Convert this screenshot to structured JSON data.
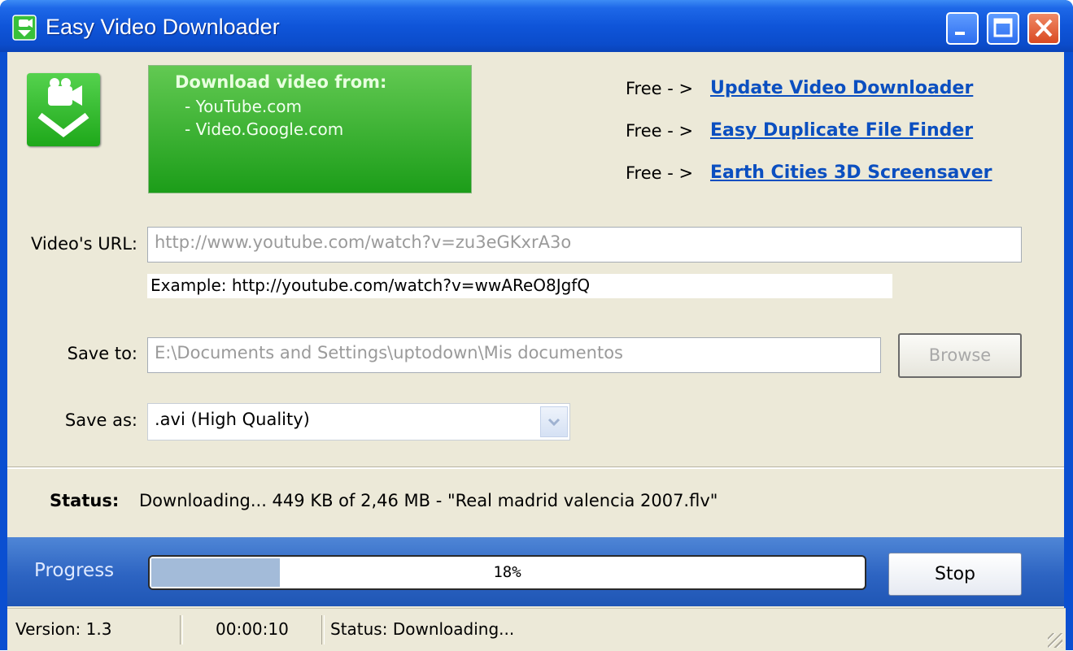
{
  "window": {
    "title": "Easy Video Downloader"
  },
  "banner": {
    "title": "Download video from:",
    "sources": [
      "- YouTube.com",
      "- Video.Google.com"
    ]
  },
  "promos": [
    {
      "prefix": "Free - >",
      "link": "Update Video Downloader"
    },
    {
      "prefix": "Free - >",
      "link": "Easy Duplicate File Finder"
    },
    {
      "prefix": "Free - >",
      "link": "Earth Cities 3D Screensaver"
    }
  ],
  "url_field": {
    "label": "Video's URL:",
    "placeholder": "http://www.youtube.com/watch?v=zu3eGKxrA3o",
    "example": "Example: http://youtube.com/watch?v=wwAReO8JgfQ"
  },
  "save_to": {
    "label": "Save to:",
    "value": "E:\\Documents and Settings\\uptodown\\Mis documentos",
    "browse_label": "Browse"
  },
  "save_as": {
    "label": "Save as:",
    "selected": ".avi (High Quality)"
  },
  "status": {
    "label": "Status:",
    "text": "Downloading... 449 KB of 2,46 MB - \"Real madrid valencia 2007.flv\""
  },
  "progress": {
    "label": "Progress",
    "percent": 18,
    "percent_text": "18%",
    "stop_label": "Stop"
  },
  "statusbar": {
    "version": "Version: 1.3",
    "elapsed": "00:00:10",
    "status": "Status: Downloading..."
  },
  "colors": {
    "titlebar": "#0f55d9",
    "banner": "#2aa526",
    "link": "#0b4fc0",
    "progress_fill": "#a3bbd9"
  }
}
